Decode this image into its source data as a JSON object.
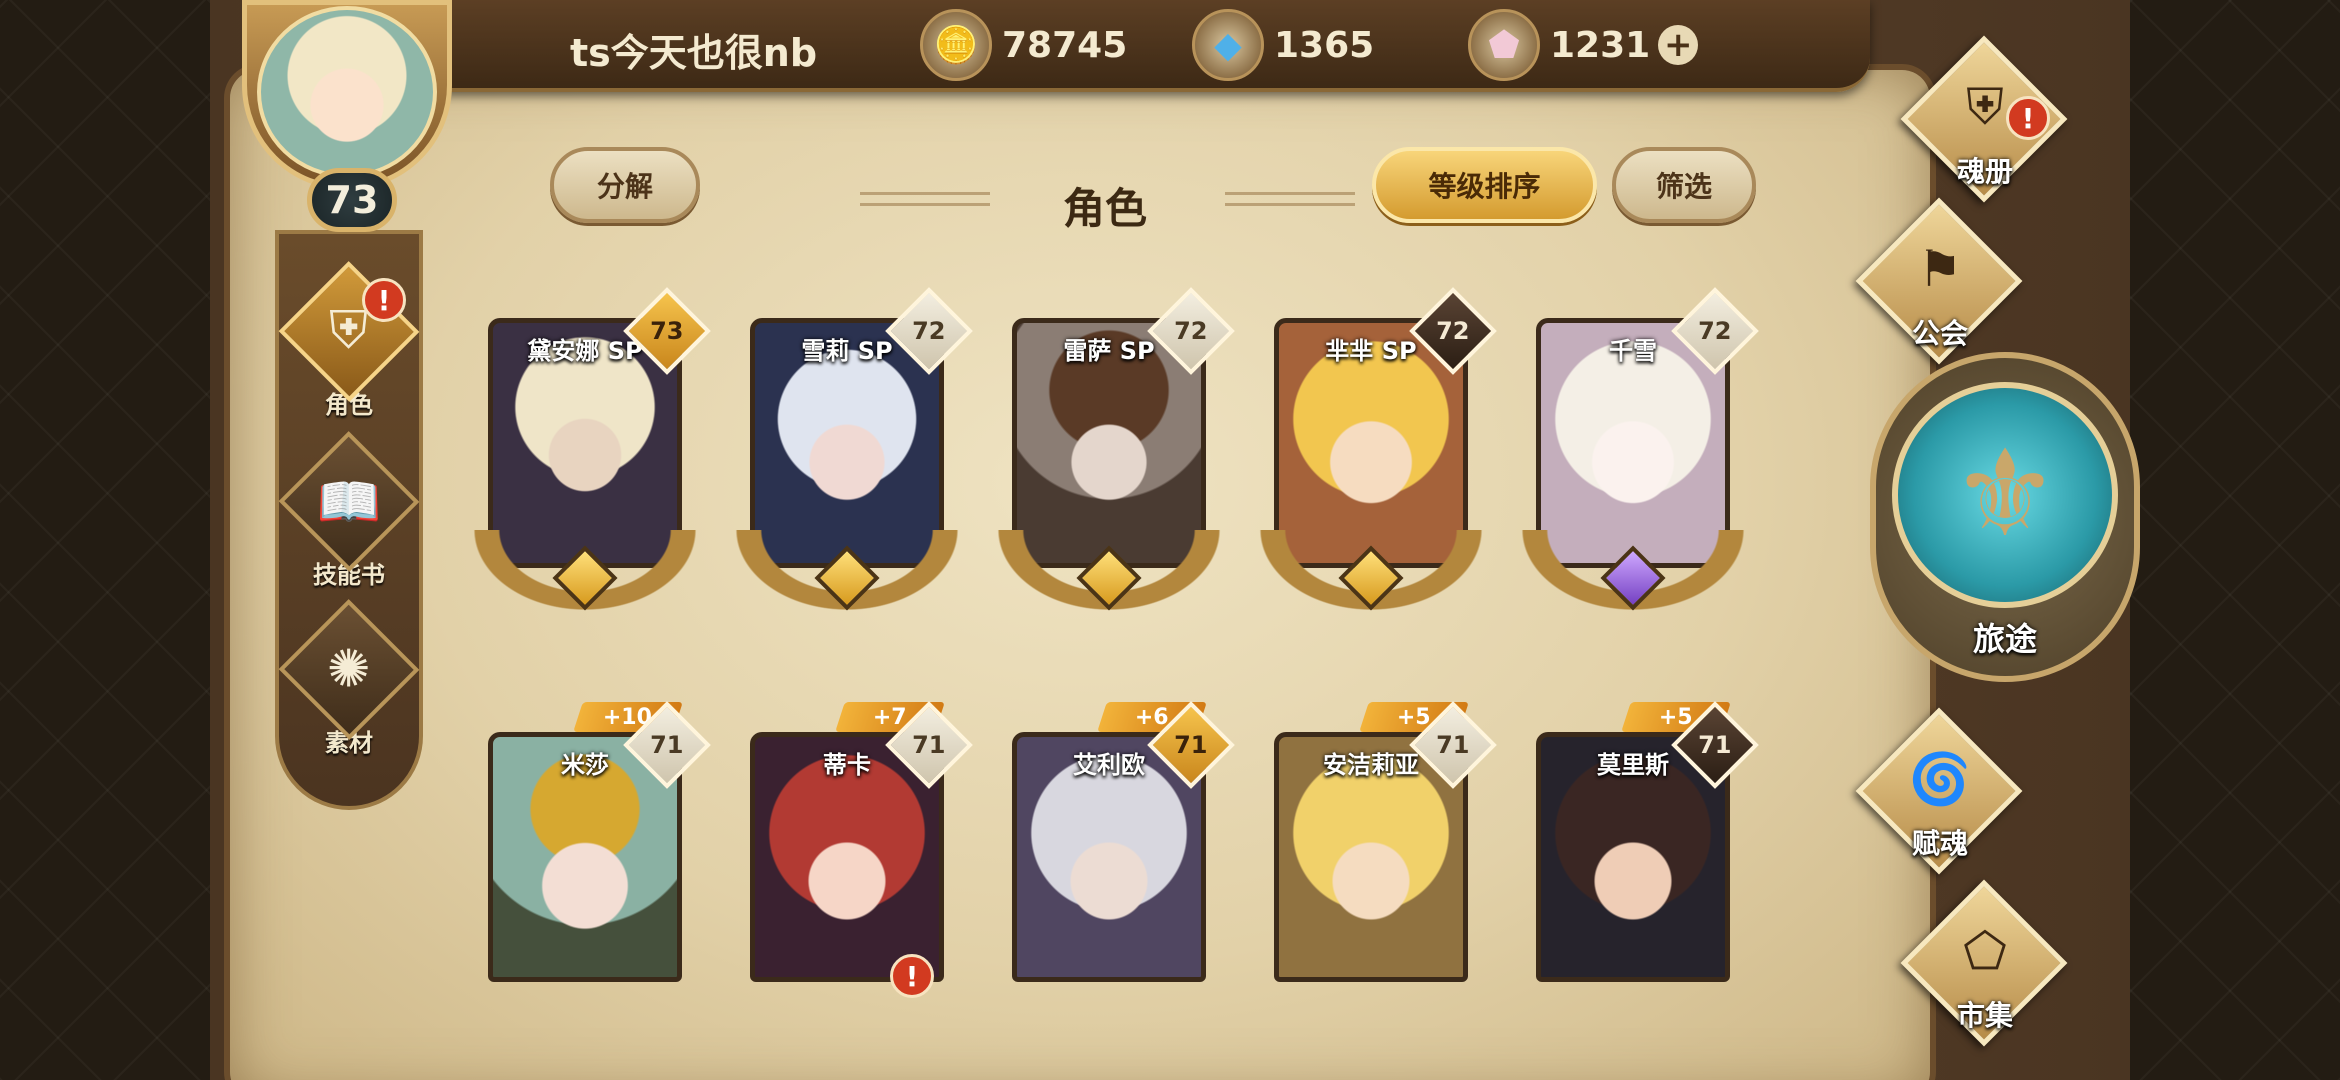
{
  "player": {
    "name": "ts今天也很nb",
    "level": "73"
  },
  "currencies": [
    {
      "icon": "gold-coin-icon",
      "value": "78745"
    },
    {
      "icon": "blue-crystal-icon",
      "value": "1365"
    },
    {
      "icon": "pink-gem-icon",
      "value": "1231"
    }
  ],
  "plus_symbol": "+",
  "sidebar": {
    "items": [
      {
        "label": "角色",
        "icon": "helmet-icon",
        "alert": "!"
      },
      {
        "label": "技能书",
        "icon": "skill-book-icon"
      },
      {
        "label": "素材",
        "icon": "material-icon"
      }
    ]
  },
  "header": {
    "title": "角色",
    "decompose": "分解",
    "sort": "等级排序",
    "filter": "筛选"
  },
  "cards": [
    {
      "name": "黛安娜 SP",
      "level": "73",
      "level_style": "gold",
      "plus": ""
    },
    {
      "name": "雪莉 SP",
      "level": "72",
      "level_style": "white",
      "plus": ""
    },
    {
      "name": "雷萨 SP",
      "level": "72",
      "level_style": "white",
      "plus": ""
    },
    {
      "name": "芈芈 SP",
      "level": "72",
      "level_style": "dark",
      "plus": ""
    },
    {
      "name": "千雪",
      "level": "72",
      "level_style": "white",
      "plus": ""
    },
    {
      "name": "米莎",
      "level": "71",
      "level_style": "white",
      "plus": "+10"
    },
    {
      "name": "蒂卡",
      "level": "71",
      "level_style": "white",
      "plus": "+7",
      "alert": "!"
    },
    {
      "name": "艾利欧",
      "level": "71",
      "level_style": "gold",
      "plus": "+6"
    },
    {
      "name": "安洁莉亚",
      "level": "71",
      "level_style": "white",
      "plus": "+5"
    },
    {
      "name": "莫里斯",
      "level": "71",
      "level_style": "dark",
      "plus": "+5"
    }
  ],
  "right_nav": {
    "soul_book": {
      "label": "魂册",
      "icon": "soul-book-icon",
      "alert": "!"
    },
    "guild": {
      "label": "公会",
      "icon": "guild-flag-icon"
    },
    "journey": {
      "label": "旅途",
      "icon": "journey-emblem-icon"
    },
    "endow": {
      "label": "赋魂",
      "icon": "endow-swirl-icon"
    },
    "market": {
      "label": "市集",
      "icon": "market-gem-icon"
    }
  }
}
